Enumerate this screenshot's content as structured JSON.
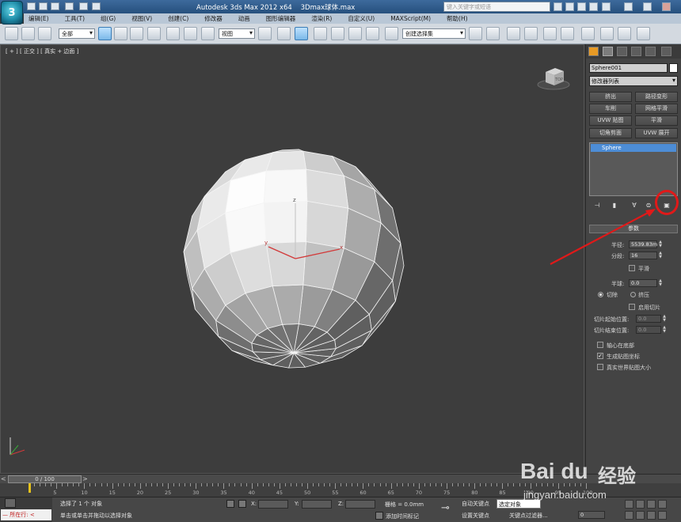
{
  "title": {
    "app_text": "Autodesk 3ds Max  2012 x64",
    "file_text": "3Dmax球体.max",
    "search_placeholder": "键入关键字或短语"
  },
  "menu": [
    "编辑(E)",
    "工具(T)",
    "组(G)",
    "视图(V)",
    "创建(C)",
    "修改器",
    "动画",
    "图形编辑器",
    "渲染(R)",
    "自定义(U)",
    "MAXScript(M)",
    "帮助(H)"
  ],
  "toolbar": {
    "selection_filter": "全部",
    "ref_coord": "视图",
    "named_selection": "创建选择集"
  },
  "viewport": {
    "label": "[ + ] [ 正交 ] [ 真实 + 边面 ]",
    "axis_x": "x",
    "axis_y": "y",
    "axis_z": "z"
  },
  "command_panel": {
    "object_name": "Sphere001",
    "modifier_list": "修改器列表",
    "modifier_buttons": [
      "挤出",
      "路径变形",
      "车削",
      "网格平滑",
      "UVW 贴图",
      "平滑",
      "切角剪面",
      "UVW 展开"
    ],
    "stack_item": "Sphere",
    "params_title": "参数",
    "radius_label": "半径:",
    "radius_value": "5539.83m",
    "segments_label": "分段:",
    "segments_value": "16",
    "smooth_label": "平滑",
    "hemisphere_label": "半球:",
    "hemisphere_value": "0.0",
    "chop_label": "切除",
    "squash_label": "挤压",
    "slice_on_label": "启用切片",
    "slice_from_label": "切片起始位置:",
    "slice_from_value": "0.0",
    "slice_to_label": "切片结束位置:",
    "slice_to_value": "0.0",
    "base_to_pivot_label": "轴心在底部",
    "gen_map_label": "生成贴图坐标",
    "real_world_label": "真实世界贴图大小"
  },
  "timeline": {
    "frame_display": "0 / 100",
    "ticks": [
      "5",
      "10",
      "15",
      "20",
      "25",
      "30",
      "35",
      "40",
      "45",
      "50",
      "55",
      "60",
      "65",
      "70",
      "75",
      "80",
      "85",
      "90",
      "95",
      "100"
    ]
  },
  "status": {
    "maxscript_text": "所在行:",
    "selection_text": "选择了 1 个 对象",
    "prompt_text": "单击或单击并拖动以选择对象",
    "x_label": "X:",
    "y_label": "Y:",
    "z_label": "Z:",
    "grid_text": "栅格 = 0.0mm",
    "add_time_tag": "添加时间标记",
    "auto_key": "自动关键点",
    "set_key": "设置关键点",
    "key_filter_dd": "选定对象",
    "key_filters": "关键点过滤器...",
    "frame_field": "0"
  },
  "watermark": {
    "brand": "Bai du",
    "brand_cn": "经验",
    "url": "jingyan.baidu.com"
  },
  "colors": {
    "title_bar": "#2e5c8c",
    "viewport_bg": "#3d3d3d",
    "highlight": "#e01919",
    "stack_selection": "#4d8dd6"
  }
}
